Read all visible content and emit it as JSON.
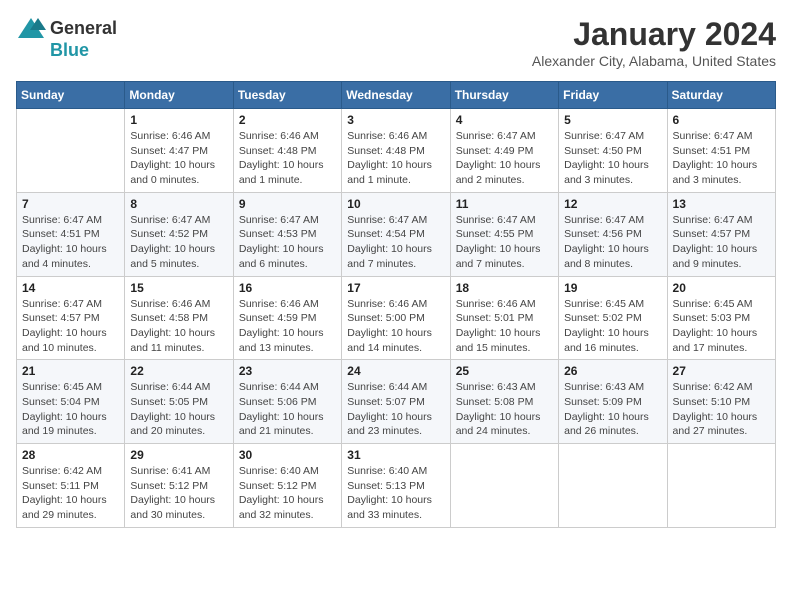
{
  "header": {
    "logo": {
      "general": "General",
      "blue": "Blue"
    },
    "title": "January 2024",
    "location": "Alexander City, Alabama, United States"
  },
  "calendar": {
    "days_of_week": [
      "Sunday",
      "Monday",
      "Tuesday",
      "Wednesday",
      "Thursday",
      "Friday",
      "Saturday"
    ],
    "weeks": [
      [
        {
          "day": "",
          "info": ""
        },
        {
          "day": "1",
          "info": "Sunrise: 6:46 AM\nSunset: 4:47 PM\nDaylight: 10 hours\nand 0 minutes."
        },
        {
          "day": "2",
          "info": "Sunrise: 6:46 AM\nSunset: 4:48 PM\nDaylight: 10 hours\nand 1 minute."
        },
        {
          "day": "3",
          "info": "Sunrise: 6:46 AM\nSunset: 4:48 PM\nDaylight: 10 hours\nand 1 minute."
        },
        {
          "day": "4",
          "info": "Sunrise: 6:47 AM\nSunset: 4:49 PM\nDaylight: 10 hours\nand 2 minutes."
        },
        {
          "day": "5",
          "info": "Sunrise: 6:47 AM\nSunset: 4:50 PM\nDaylight: 10 hours\nand 3 minutes."
        },
        {
          "day": "6",
          "info": "Sunrise: 6:47 AM\nSunset: 4:51 PM\nDaylight: 10 hours\nand 3 minutes."
        }
      ],
      [
        {
          "day": "7",
          "info": "Sunrise: 6:47 AM\nSunset: 4:51 PM\nDaylight: 10 hours\nand 4 minutes."
        },
        {
          "day": "8",
          "info": "Sunrise: 6:47 AM\nSunset: 4:52 PM\nDaylight: 10 hours\nand 5 minutes."
        },
        {
          "day": "9",
          "info": "Sunrise: 6:47 AM\nSunset: 4:53 PM\nDaylight: 10 hours\nand 6 minutes."
        },
        {
          "day": "10",
          "info": "Sunrise: 6:47 AM\nSunset: 4:54 PM\nDaylight: 10 hours\nand 7 minutes."
        },
        {
          "day": "11",
          "info": "Sunrise: 6:47 AM\nSunset: 4:55 PM\nDaylight: 10 hours\nand 7 minutes."
        },
        {
          "day": "12",
          "info": "Sunrise: 6:47 AM\nSunset: 4:56 PM\nDaylight: 10 hours\nand 8 minutes."
        },
        {
          "day": "13",
          "info": "Sunrise: 6:47 AM\nSunset: 4:57 PM\nDaylight: 10 hours\nand 9 minutes."
        }
      ],
      [
        {
          "day": "14",
          "info": "Sunrise: 6:47 AM\nSunset: 4:57 PM\nDaylight: 10 hours\nand 10 minutes."
        },
        {
          "day": "15",
          "info": "Sunrise: 6:46 AM\nSunset: 4:58 PM\nDaylight: 10 hours\nand 11 minutes."
        },
        {
          "day": "16",
          "info": "Sunrise: 6:46 AM\nSunset: 4:59 PM\nDaylight: 10 hours\nand 13 minutes."
        },
        {
          "day": "17",
          "info": "Sunrise: 6:46 AM\nSunset: 5:00 PM\nDaylight: 10 hours\nand 14 minutes."
        },
        {
          "day": "18",
          "info": "Sunrise: 6:46 AM\nSunset: 5:01 PM\nDaylight: 10 hours\nand 15 minutes."
        },
        {
          "day": "19",
          "info": "Sunrise: 6:45 AM\nSunset: 5:02 PM\nDaylight: 10 hours\nand 16 minutes."
        },
        {
          "day": "20",
          "info": "Sunrise: 6:45 AM\nSunset: 5:03 PM\nDaylight: 10 hours\nand 17 minutes."
        }
      ],
      [
        {
          "day": "21",
          "info": "Sunrise: 6:45 AM\nSunset: 5:04 PM\nDaylight: 10 hours\nand 19 minutes."
        },
        {
          "day": "22",
          "info": "Sunrise: 6:44 AM\nSunset: 5:05 PM\nDaylight: 10 hours\nand 20 minutes."
        },
        {
          "day": "23",
          "info": "Sunrise: 6:44 AM\nSunset: 5:06 PM\nDaylight: 10 hours\nand 21 minutes."
        },
        {
          "day": "24",
          "info": "Sunrise: 6:44 AM\nSunset: 5:07 PM\nDaylight: 10 hours\nand 23 minutes."
        },
        {
          "day": "25",
          "info": "Sunrise: 6:43 AM\nSunset: 5:08 PM\nDaylight: 10 hours\nand 24 minutes."
        },
        {
          "day": "26",
          "info": "Sunrise: 6:43 AM\nSunset: 5:09 PM\nDaylight: 10 hours\nand 26 minutes."
        },
        {
          "day": "27",
          "info": "Sunrise: 6:42 AM\nSunset: 5:10 PM\nDaylight: 10 hours\nand 27 minutes."
        }
      ],
      [
        {
          "day": "28",
          "info": "Sunrise: 6:42 AM\nSunset: 5:11 PM\nDaylight: 10 hours\nand 29 minutes."
        },
        {
          "day": "29",
          "info": "Sunrise: 6:41 AM\nSunset: 5:12 PM\nDaylight: 10 hours\nand 30 minutes."
        },
        {
          "day": "30",
          "info": "Sunrise: 6:40 AM\nSunset: 5:12 PM\nDaylight: 10 hours\nand 32 minutes."
        },
        {
          "day": "31",
          "info": "Sunrise: 6:40 AM\nSunset: 5:13 PM\nDaylight: 10 hours\nand 33 minutes."
        },
        {
          "day": "",
          "info": ""
        },
        {
          "day": "",
          "info": ""
        },
        {
          "day": "",
          "info": ""
        }
      ]
    ]
  }
}
